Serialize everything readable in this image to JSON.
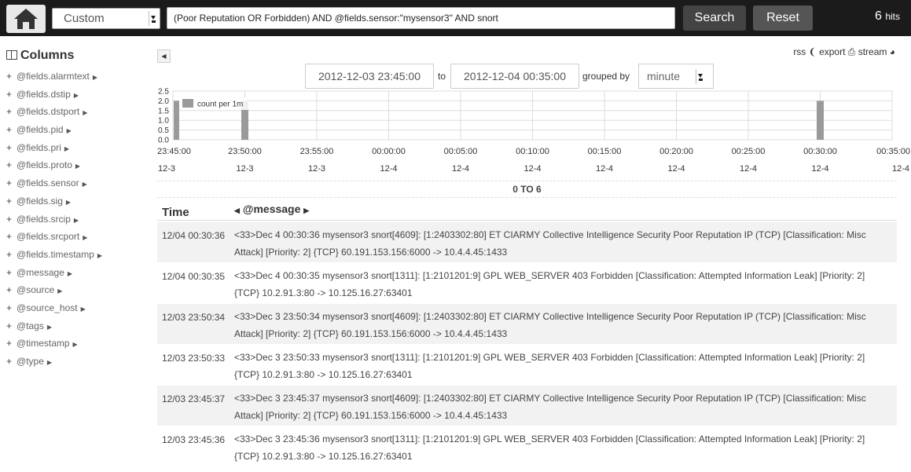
{
  "topbar": {
    "logo_icon": "home-icon",
    "mode": "Custom",
    "query": "(Poor Reputation OR Forbidden) AND @fields.sensor:\"mysensor3\" AND snort",
    "search_label": "Search",
    "reset_label": "Reset",
    "hits_count": "6",
    "hits_label": "hits"
  },
  "sidebar": {
    "title": "Columns",
    "fields": [
      "@fields.alarmtext",
      "@fields.dstip",
      "@fields.dstport",
      "@fields.pid",
      "@fields.pri",
      "@fields.proto",
      "@fields.sensor",
      "@fields.sig",
      "@fields.srcip",
      "@fields.srcport",
      "@fields.timestamp",
      "@message",
      "@source",
      "@source_host",
      "@tags",
      "@timestamp",
      "@type"
    ]
  },
  "toolbar": {
    "rss": "rss",
    "export": "export",
    "stream": "stream",
    "from": "2012-12-03 23:45:00",
    "to_label": "to",
    "to": "2012-12-04 00:35:00",
    "grouped_by_label": "grouped by",
    "interval": "minute"
  },
  "chart_data": {
    "type": "bar",
    "legend": "count per 1m",
    "ylim": [
      0,
      2.5
    ],
    "yticks": [
      "2.5",
      "2.0",
      "1.5",
      "1.0",
      "0.5",
      "0.0"
    ],
    "xticks": [
      {
        "time": "23:45:00",
        "date": "12-3"
      },
      {
        "time": "23:50:00",
        "date": "12-3"
      },
      {
        "time": "23:55:00",
        "date": "12-3"
      },
      {
        "time": "00:00:00",
        "date": "12-4"
      },
      {
        "time": "00:05:00",
        "date": "12-4"
      },
      {
        "time": "00:10:00",
        "date": "12-4"
      },
      {
        "time": "00:15:00",
        "date": "12-4"
      },
      {
        "time": "00:20:00",
        "date": "12-4"
      },
      {
        "time": "00:25:00",
        "date": "12-4"
      },
      {
        "time": "00:30:00",
        "date": "12-4"
      },
      {
        "time": "00:35:00",
        "date": "12-4"
      }
    ],
    "x_minutes": [
      0,
      50
    ],
    "bars": [
      {
        "minute": 0,
        "value": 2
      },
      {
        "minute": 5,
        "value": 2
      },
      {
        "minute": 45,
        "value": 2
      }
    ]
  },
  "range_label": "0 TO 6",
  "table": {
    "time_header": "Time",
    "message_header": "@message",
    "rows": [
      {
        "time": "12/04 00:30:36",
        "message": "<33>Dec  4 00:30:36 mysensor3 snort[4609]: [1:2403302:80] ET CIARMY Collective Intelligence Security Poor Reputation IP (TCP) [Classification: Misc Attack] [Priority: 2] {TCP} 60.191.153.156:6000 -> 10.4.4.45:1433"
      },
      {
        "time": "12/04 00:30:35",
        "message": "<33>Dec  4 00:30:35 mysensor3 snort[1311]: [1:2101201:9] GPL WEB_SERVER 403 Forbidden [Classification: Attempted Information Leak] [Priority: 2] {TCP} 10.2.91.3:80 -> 10.125.16.27:63401"
      },
      {
        "time": "12/03 23:50:34",
        "message": "<33>Dec  3 23:50:34 mysensor3 snort[4609]: [1:2403302:80] ET CIARMY Collective Intelligence Security Poor Reputation IP (TCP) [Classification: Misc Attack] [Priority: 2] {TCP} 60.191.153.156:6000 -> 10.4.4.45:1433"
      },
      {
        "time": "12/03 23:50:33",
        "message": "<33>Dec  3 23:50:33 mysensor3 snort[1311]: [1:2101201:9] GPL WEB_SERVER 403 Forbidden [Classification: Attempted Information Leak] [Priority: 2] {TCP} 10.2.91.3:80 -> 10.125.16.27:63401"
      },
      {
        "time": "12/03 23:45:37",
        "message": "<33>Dec  3 23:45:37 mysensor3 snort[4609]: [1:2403302:80] ET CIARMY Collective Intelligence Security Poor Reputation IP (TCP) [Classification: Misc Attack] [Priority: 2] {TCP} 60.191.153.156:6000 -> 10.4.4.45:1433"
      },
      {
        "time": "12/03 23:45:36",
        "message": "<33>Dec  3 23:45:36 mysensor3 snort[1311]: [1:2101201:9] GPL WEB_SERVER 403 Forbidden [Classification: Attempted Information Leak] [Priority: 2] {TCP} 10.2.91.3:80 -> 10.125.16.27:63401"
      }
    ]
  }
}
